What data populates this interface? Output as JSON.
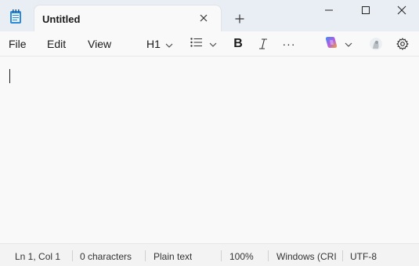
{
  "tab": {
    "title": "Untitled"
  },
  "menu": {
    "file": "File",
    "edit": "Edit",
    "view": "View"
  },
  "toolbar": {
    "heading": "H1",
    "bold": "B",
    "more": "···"
  },
  "status": {
    "position": "Ln 1, Col 1",
    "characters": "0 characters",
    "format": "Plain text",
    "zoom": "100%",
    "line_ending": "Windows (CRI",
    "encoding": "UTF-8"
  },
  "icons": {
    "app": "notepad-icon",
    "close_tab": "close-icon",
    "new_tab": "plus-icon",
    "minimize": "minimize-icon",
    "maximize": "maximize-icon",
    "close_window": "close-icon",
    "list": "list-icon",
    "italic": "italic-icon",
    "copilot": "copilot-icon",
    "avatar": "avatar-icon",
    "settings": "gear-icon"
  },
  "colors": {
    "accent": "#0a7ad6",
    "titlebar": "#e9eef4"
  }
}
